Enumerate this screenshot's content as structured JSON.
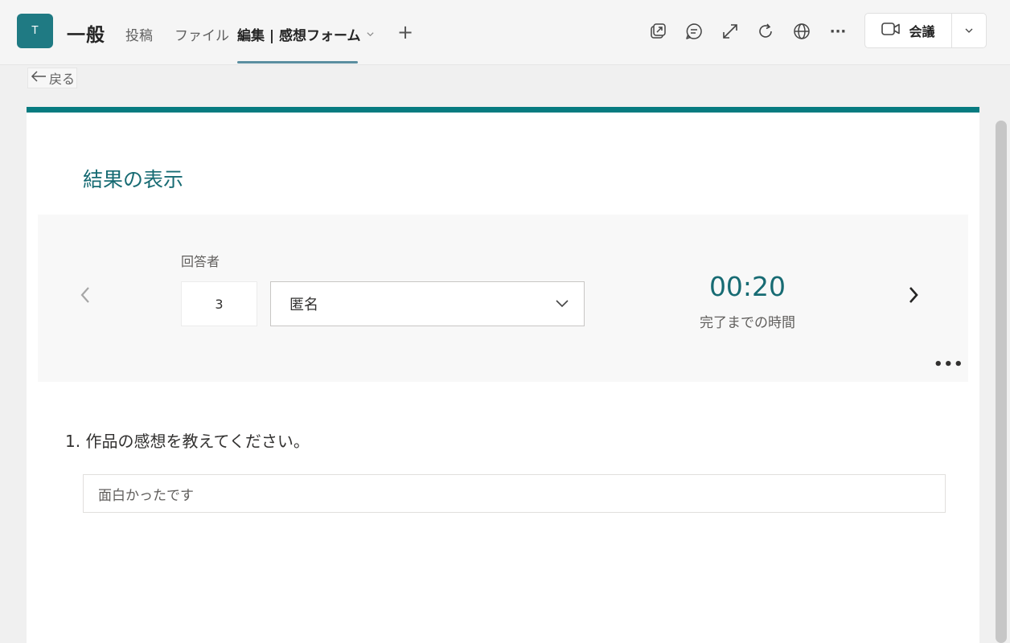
{
  "header": {
    "team_initial": "T",
    "channel_name": "一般",
    "tabs": [
      {
        "label": "投稿"
      },
      {
        "label": "ファイル"
      },
      {
        "label": "編集 | 感想フォーム"
      }
    ],
    "add_tab": "+",
    "more_label": "···",
    "meeting_label": "会議"
  },
  "icons": {
    "popout": "popout-icon",
    "chat": "chat-icon",
    "expand": "expand-icon",
    "refresh": "refresh-icon",
    "web": "globe-icon",
    "video": "video-camera-icon"
  },
  "back": {
    "label": "戻る"
  },
  "results": {
    "title": "結果の表示",
    "responder_label": "回答者",
    "responder_number": "3",
    "responder_name": "匿名",
    "time_value": "00:20",
    "time_label": "完了までの時間",
    "more": "•••"
  },
  "question": {
    "text": "1. 作品の感想を教えてください。",
    "answer": "面白かったです"
  },
  "colors": {
    "accent": "#077b80",
    "title": "#176b73",
    "avatar": "#1f7a83"
  }
}
